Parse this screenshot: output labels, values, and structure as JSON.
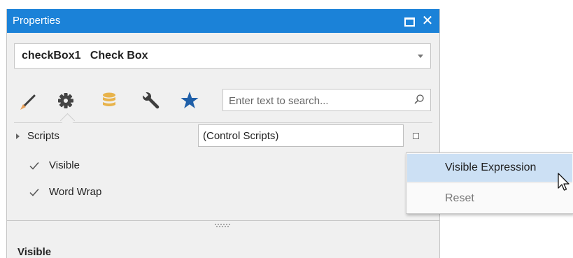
{
  "panel": {
    "title": "Properties",
    "controls": {
      "maximize_icon": "maximize-icon",
      "close_icon": "close-icon",
      "close_glyph": "✕"
    }
  },
  "object_selector": {
    "name": "checkBox1",
    "type": "Check Box"
  },
  "tabs": [
    {
      "icon": "appearance-brush-icon",
      "active": false
    },
    {
      "icon": "behavior-gear-icon",
      "active": true
    },
    {
      "icon": "data-database-icon",
      "active": false
    },
    {
      "icon": "layout-wrench-icon",
      "active": false
    },
    {
      "icon": "favorites-star-icon",
      "active": false
    }
  ],
  "search": {
    "placeholder": "Enter text to search..."
  },
  "properties": {
    "scripts": {
      "label": "Scripts",
      "value": "(Control Scripts)"
    },
    "visible": {
      "label": "Visible",
      "checked": true
    },
    "word_wrap": {
      "label": "Word Wrap",
      "checked": true
    }
  },
  "description": {
    "title": "Visible"
  },
  "context_menu": {
    "items": [
      {
        "label": "Visible Expression",
        "highlighted": true
      },
      {
        "label": "Reset",
        "disabled": true
      }
    ]
  },
  "colors": {
    "title_bar": "#1b82d8",
    "panel_bg": "#f0f0f0",
    "menu_highlight": "#cce0f4",
    "star": "#1f5fa8",
    "database": "#e8b34b",
    "brush_tip": "#e8a05a"
  }
}
